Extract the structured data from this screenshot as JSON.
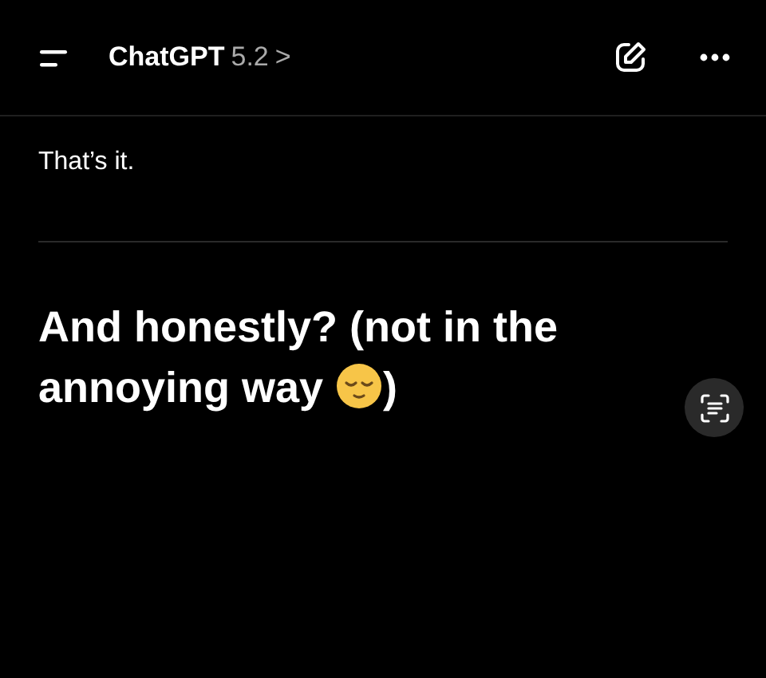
{
  "header": {
    "title": "ChatGPT",
    "version": "5.2",
    "chevron": ">"
  },
  "messages": [
    {
      "kind": "text",
      "text": "That’s it."
    },
    {
      "kind": "divider"
    },
    {
      "kind": "heading",
      "text": "And honestly? (not in the annoying way",
      "after": ")"
    }
  ]
}
